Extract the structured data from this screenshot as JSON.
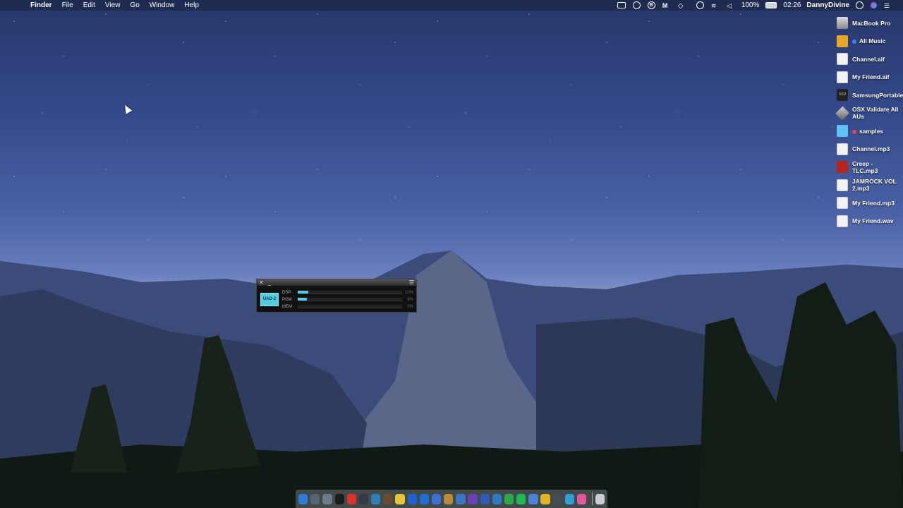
{
  "menubar": {
    "app_name": "Finder",
    "menus": [
      "File",
      "Edit",
      "View",
      "Go",
      "Window",
      "Help"
    ],
    "battery": "100%",
    "time": "02:26",
    "user": "DannyDivine"
  },
  "desktop_icons": [
    {
      "label": "MacBook Pro",
      "kind": "drive",
      "tag": ""
    },
    {
      "label": "All Music",
      "kind": "folder-y",
      "tag": "#3b82f6"
    },
    {
      "label": "Channel.aif",
      "kind": "file",
      "tag": ""
    },
    {
      "label": "My Friend.aif",
      "kind": "file",
      "tag": ""
    },
    {
      "label": "SamsungPortableSSD",
      "kind": "ssd",
      "tag": ""
    },
    {
      "label": "OSX Validate All AUs",
      "kind": "diamond",
      "tag": ""
    },
    {
      "label": "samples",
      "kind": "folder-b",
      "tag": "#ef4444"
    },
    {
      "label": "Channel.mp3",
      "kind": "file",
      "tag": ""
    },
    {
      "label": "Creep - TLC.mp3",
      "kind": "album",
      "tag": ""
    },
    {
      "label": "JAMROCK VOL 2.mp3",
      "kind": "file",
      "tag": ""
    },
    {
      "label": "My Friend.mp3",
      "kind": "file",
      "tag": ""
    },
    {
      "label": "My Friend.wav",
      "kind": "file",
      "tag": ""
    }
  ],
  "uad_meter": {
    "logo": "UAD-2",
    "rows": [
      {
        "key": "DSP",
        "value": "10%",
        "fill": 0.1
      },
      {
        "key": "PGM",
        "value": "9%",
        "fill": 0.09
      },
      {
        "key": "MEM",
        "value": "0%",
        "fill": 0.0
      }
    ]
  },
  "dock": {
    "apps": [
      {
        "name": "finder",
        "color": "#2f7bdc"
      },
      {
        "name": "mail-plane",
        "color": "#5b6472"
      },
      {
        "name": "preview",
        "color": "#6d7a8a"
      },
      {
        "name": "safari",
        "color": "#1d1d1d"
      },
      {
        "name": "opera",
        "color": "#e0302a"
      },
      {
        "name": "steam",
        "color": "#333a45"
      },
      {
        "name": "xcode",
        "color": "#2c7fb8"
      },
      {
        "name": "scissors",
        "color": "#6a4b2d"
      },
      {
        "name": "notes",
        "color": "#e8c235"
      },
      {
        "name": "safari-blue",
        "color": "#2060d0"
      },
      {
        "name": "bbedit",
        "color": "#1f6fd8"
      },
      {
        "name": "downloader",
        "color": "#3d6fd6"
      },
      {
        "name": "folder",
        "color": "#b88a3a"
      },
      {
        "name": "torrent",
        "color": "#3777c2"
      },
      {
        "name": "firefox",
        "color": "#6b3fb5"
      },
      {
        "name": "word",
        "color": "#2a5cb8"
      },
      {
        "name": "wordpress",
        "color": "#3179c2"
      },
      {
        "name": "messages",
        "color": "#2ba84a"
      },
      {
        "name": "spotify",
        "color": "#1db954"
      },
      {
        "name": "mail",
        "color": "#4a83d6"
      },
      {
        "name": "logic",
        "color": "#e0b323"
      },
      {
        "name": "headphones",
        "color": "#444b55"
      },
      {
        "name": "stream",
        "color": "#2ca0d6"
      },
      {
        "name": "itunes",
        "color": "#e8569a"
      }
    ],
    "trash": "trash"
  }
}
